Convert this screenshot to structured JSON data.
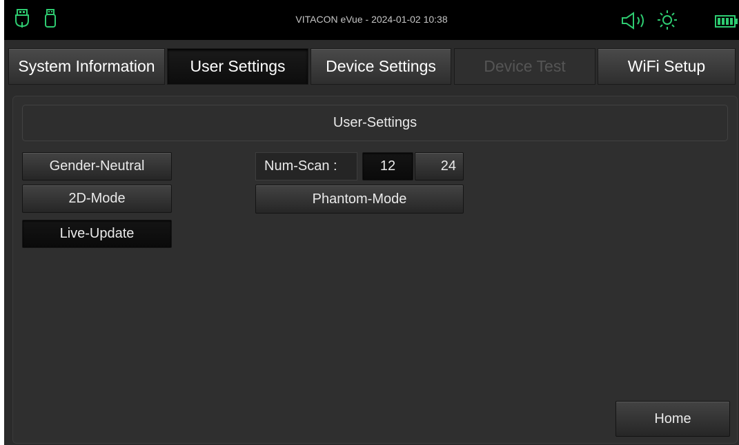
{
  "status_bar": {
    "title": "VITACON eVue - 2024-01-02 10:38",
    "icons": [
      "usb-icon",
      "usb-drive-icon",
      "speaker-volume-icon",
      "brightness-icon",
      "battery-icon"
    ],
    "accent_color": "#2ecc71"
  },
  "tabs": [
    {
      "label": "System Information",
      "state": "normal"
    },
    {
      "label": "User Settings",
      "state": "active"
    },
    {
      "label": "Device Settings",
      "state": "normal"
    },
    {
      "label": "Device Test",
      "state": "disabled"
    },
    {
      "label": "WiFi Setup",
      "state": "normal"
    }
  ],
  "section": {
    "title": "User-Settings"
  },
  "options": {
    "gender_neutral": "Gender-Neutral",
    "mode_2d": "2D-Mode",
    "live_update": "Live-Update",
    "num_scan_label": "Num-Scan :",
    "num_scan_options": [
      "12",
      "24"
    ],
    "num_scan_selected": "12",
    "phantom_mode": "Phantom-Mode"
  },
  "footer": {
    "home_label": "Home"
  }
}
